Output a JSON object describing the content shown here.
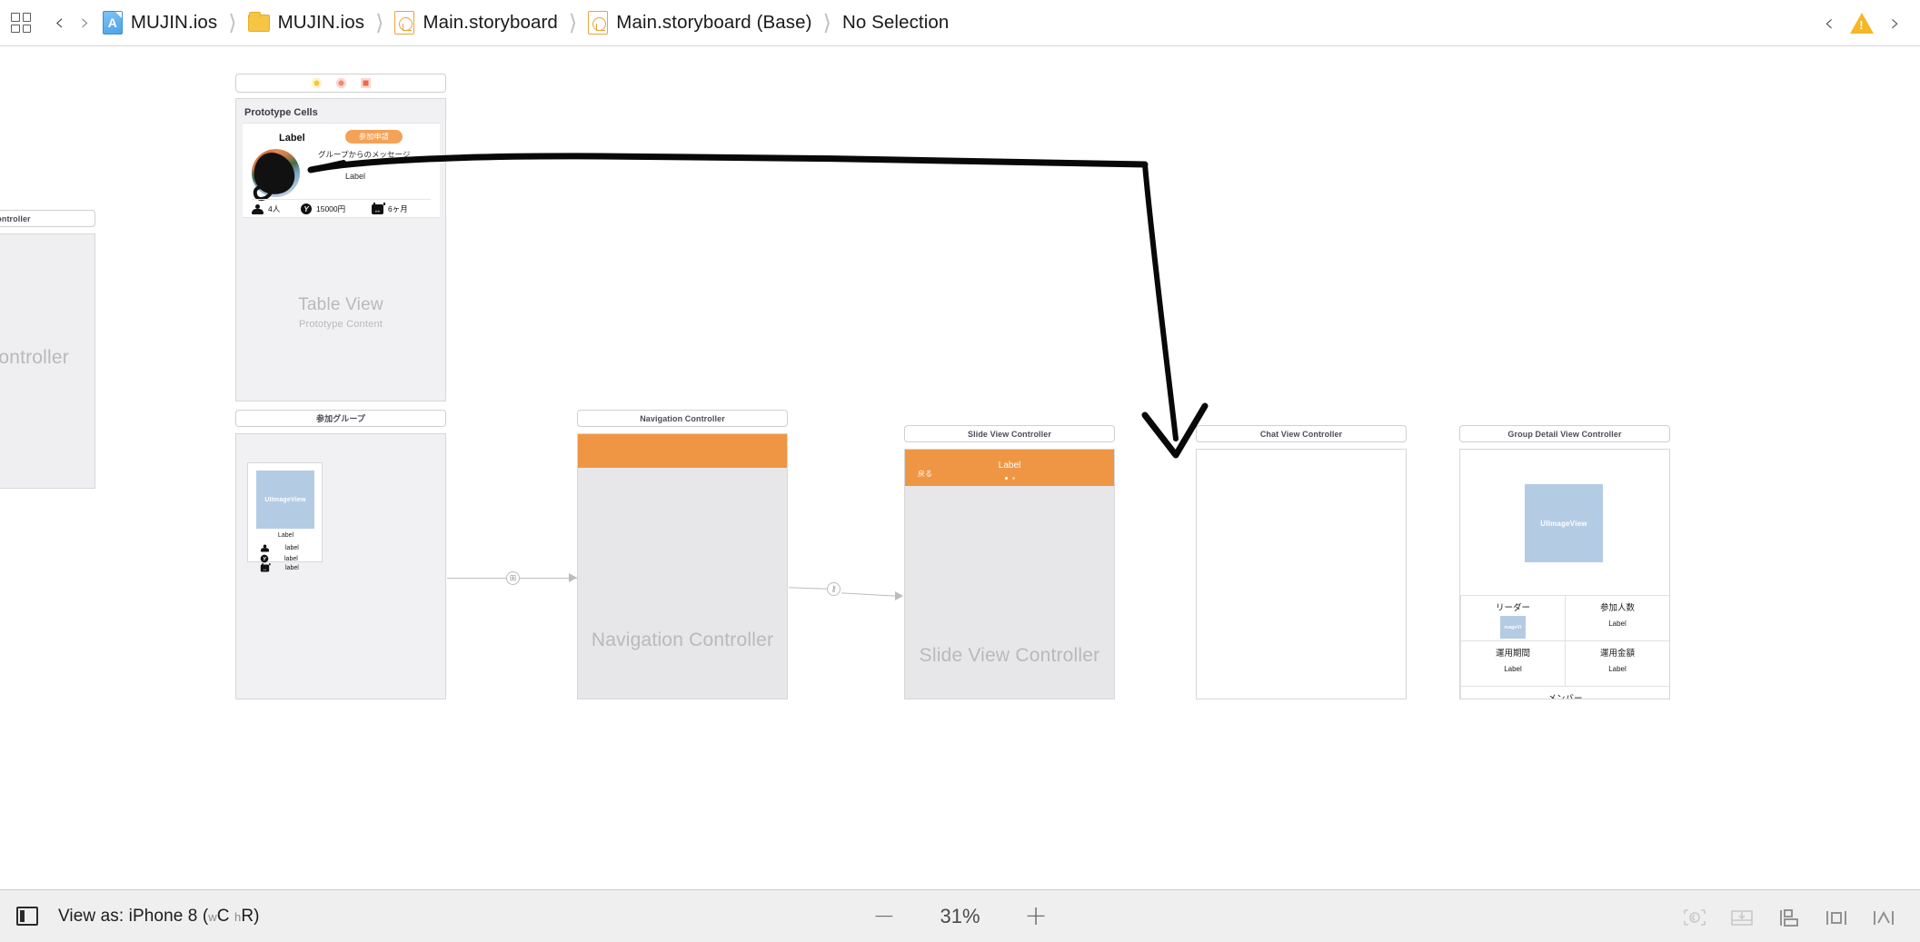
{
  "jump_bar": {
    "grid_icon": "grid-icon",
    "back_label": "‹",
    "forward_label": "›",
    "breadcrumbs": [
      {
        "icon": "xcode-project-icon",
        "label": "MUJIN.ios"
      },
      {
        "icon": "folder-icon",
        "label": "MUJIN.ios"
      },
      {
        "icon": "storyboard-icon",
        "label": "Main.storyboard"
      },
      {
        "icon": "storyboard-icon",
        "label": "Main.storyboard (Base)"
      },
      {
        "icon": "none",
        "label": "No Selection"
      }
    ],
    "issue_prev": "‹",
    "issue_icon": "warning-triangle-icon",
    "issue_next": "›"
  },
  "canvas": {
    "left_partial_scene": {
      "title": "View Controller",
      "ghost": "ew Controller"
    },
    "prototype_scene": {
      "dock": [
        {
          "name": "view-controller-dock-icon"
        },
        {
          "name": "first-responder-dock-icon"
        },
        {
          "name": "exit-dock-icon"
        }
      ],
      "section_header": "Prototype Cells",
      "cell": {
        "title_label": "Label",
        "apply_button": "参加申請",
        "message_caption": "グループからのメッセージ",
        "message_value": "Label",
        "stats": [
          {
            "icon": "people-icon",
            "value": "4人"
          },
          {
            "icon": "yen-icon",
            "value": "15000円"
          },
          {
            "icon": "duration-icon",
            "value": "6ヶ月"
          }
        ]
      },
      "table_view_ghost": "Table View",
      "table_view_sub": "Prototype Content"
    },
    "scenes": [
      {
        "title": "参加グループ",
        "cell": {
          "image_label": "UIImageView",
          "name_label": "Label",
          "rows": [
            {
              "icon": "people-icon",
              "label": "label"
            },
            {
              "icon": "yen-icon",
              "label": "label"
            },
            {
              "icon": "duration-icon",
              "label": "label"
            }
          ]
        }
      },
      {
        "title": "Navigation Controller",
        "ghost": "Navigation Controller"
      },
      {
        "title": "Slide View Controller",
        "ghost": "Slide View Controller",
        "nav": {
          "back": "戻る",
          "title": "Label",
          "dots": 2,
          "active_dot": 0
        }
      },
      {
        "title": "Chat View Controller"
      },
      {
        "title": "Group Detail View Controller",
        "image_label": "UIImageView",
        "table": [
          {
            "head": "リーダー",
            "value": "mageVi",
            "value_is_image": true
          },
          {
            "head": "参加人数",
            "value": "Label"
          },
          {
            "head": "運用期間",
            "value": "Label"
          },
          {
            "head": "運用金額",
            "value": "Label"
          }
        ],
        "members_head": "メンバー"
      }
    ],
    "segues": [
      {
        "badge": "⊞"
      },
      {
        "badge": "⚷"
      }
    ],
    "annotation": "hand-drawn-arrow"
  },
  "bottom_bar": {
    "panel_toggle": "panel-toggle-icon",
    "view_as_prefix": "View as: iPhone 8 ",
    "view_as_traits_w": "w",
    "view_as_traits_c": "C",
    "view_as_traits_h": "h",
    "view_as_traits_r": "R",
    "zoom_out": "−",
    "zoom_value": "31%",
    "zoom_in": "+",
    "tools": [
      "update-frames-icon",
      "embed-in-icon",
      "align-icon",
      "add-constraints-icon",
      "resolve-issues-icon"
    ]
  },
  "colors": {
    "accent_orange": "#ef9644",
    "button_orange": "#f4a258",
    "warning_yellow": "#f5b728",
    "image_placeholder": "#b4cbe4",
    "scene_gray": "#efeff1"
  }
}
